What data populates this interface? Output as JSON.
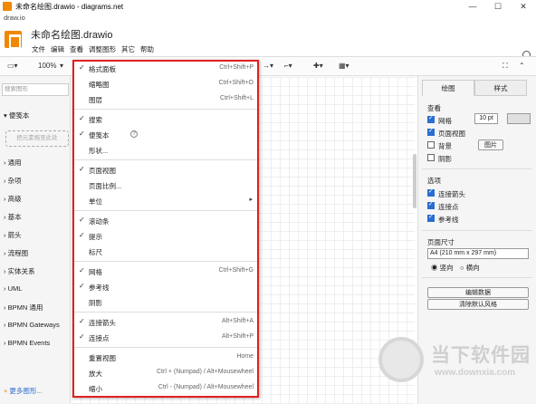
{
  "window": {
    "title": "未命名绘图.drawio - diagrams.net",
    "url": "draw.io",
    "controls": [
      "—",
      "☐",
      "✕"
    ]
  },
  "header": {
    "doc_title": "未命名绘图.drawio",
    "menu": [
      "文件",
      "编辑",
      "查看",
      "调整图形",
      "其它",
      "帮助"
    ]
  },
  "toolbar": {
    "zoom": "100%"
  },
  "sidebar": {
    "search_placeholder": "搜索图形",
    "scratchpad": "便笺本",
    "drop_hint": "把元素拖至此处",
    "categories": [
      "通用",
      "杂项",
      "高级",
      "基本",
      "箭头",
      "流程图",
      "实体关系",
      "UML",
      "BPMN 通用",
      "BPMN Gateways",
      "BPMN Events"
    ],
    "more_shapes": "更多图形..."
  },
  "view_menu": {
    "items": [
      {
        "label": "格式面板",
        "shortcut": "Ctrl+Shift+P",
        "checked": true
      },
      {
        "label": "缩略图",
        "shortcut": "Ctrl+Shift+O",
        "checked": false
      },
      {
        "label": "图层",
        "shortcut": "Ctrl+Shift+L",
        "checked": false
      },
      {
        "label": "搜索",
        "shortcut": "",
        "checked": true
      },
      {
        "label": "便笺本",
        "shortcut": "",
        "checked": true
      },
      {
        "label": "形状...",
        "shortcut": "",
        "checked": false
      },
      {
        "label": "页面视图",
        "shortcut": "",
        "checked": true
      },
      {
        "label": "页面比例...",
        "shortcut": "",
        "checked": false
      },
      {
        "label": "单位",
        "shortcut": "",
        "checked": false
      },
      {
        "label": "滚动条",
        "shortcut": "",
        "checked": true
      },
      {
        "label": "提示",
        "shortcut": "",
        "checked": true
      },
      {
        "label": "标尺",
        "shortcut": "",
        "checked": false
      },
      {
        "label": "网格",
        "shortcut": "Ctrl+Shift+G",
        "checked": true
      },
      {
        "label": "参考线",
        "shortcut": "",
        "checked": true
      },
      {
        "label": "阴影",
        "shortcut": "",
        "checked": false
      },
      {
        "label": "连接箭头",
        "shortcut": "Alt+Shift+A",
        "checked": true
      },
      {
        "label": "连接点",
        "shortcut": "Alt+Shift+P",
        "checked": true
      },
      {
        "label": "重置视图",
        "shortcut": "Home",
        "checked": false
      },
      {
        "label": "放大",
        "shortcut": "Ctrl + (Numpad) / Alt+Mousewheel",
        "checked": false
      },
      {
        "label": "缩小",
        "shortcut": "Ctrl - (Numpad) / Alt+Mousewheel",
        "checked": false
      }
    ]
  },
  "format_panel": {
    "tabs": [
      "绘图",
      "样式"
    ],
    "view_heading": "查看",
    "grid_label": "网格",
    "grid_size": "10 pt",
    "page_view_label": "页面视图",
    "background_label": "背景",
    "image_button": "图片",
    "shadow_label": "阴影",
    "options_heading": "选项",
    "connection_arrows": "连接箭头",
    "connection_points": "连接点",
    "guides": "参考线",
    "paper_size_heading": "页面尺寸",
    "paper_size": "A4 (210 mm x 297 mm)",
    "portrait": "竖向",
    "landscape": "横向",
    "edit_data_button": "编辑数据",
    "clear_style_button": "清除默认风格"
  },
  "watermark": {
    "text": "当下软件园",
    "url": "www.downxia.com"
  }
}
